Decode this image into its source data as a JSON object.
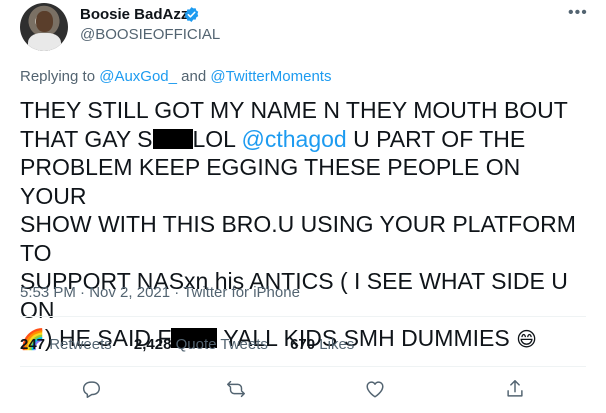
{
  "author": {
    "name": "Boosie BadAzz",
    "handle": "@BOOSIEOFFICIAL",
    "verified": true
  },
  "replying_to": {
    "prefix": "Replying to",
    "user1": "@AuxGod_",
    "and": "and",
    "user2": "@TwitterMoments"
  },
  "tweet": {
    "line1": "THEY STILL GOT MY NAME N THEY  MOUTH BOUT",
    "line2a": "THAT GAY S",
    "line2b": "LOL",
    "mention": "@cthagod",
    "line2c": "U PART OF THE",
    "line3": "PROBLEM KEEP EGGING THESE PEOPLE ON YOUR",
    "line4": "SHOW WITH THIS BRO.U USING YOUR PLATFORM TO",
    "line5": "SUPPORT NASxn his ANTICS ( I SEE WHAT SIDE U ON",
    "line6a": ") HE SAID F",
    "line6b": "YALL KIDS SMH DUMMIES",
    "rainbow_emoji": "🌈",
    "grin_emoji": "😄"
  },
  "meta": {
    "time": "5:53 PM",
    "date": "Nov 2, 2021",
    "source": "Twitter for iPhone"
  },
  "stats": {
    "retweets_count": "247",
    "retweets_label": "Retweets",
    "quotes_count": "2,428",
    "quotes_label": "Quote Tweets",
    "likes_count": "670",
    "likes_label": "Likes"
  },
  "icons": {
    "more": "more-icon",
    "reply": "reply-icon",
    "retweet": "retweet-icon",
    "like": "like-icon",
    "share": "share-icon",
    "verified": "verified-badge-icon"
  },
  "colors": {
    "link": "#1d9bf0",
    "secondary_text": "#536471",
    "primary_text": "#0f1419"
  }
}
